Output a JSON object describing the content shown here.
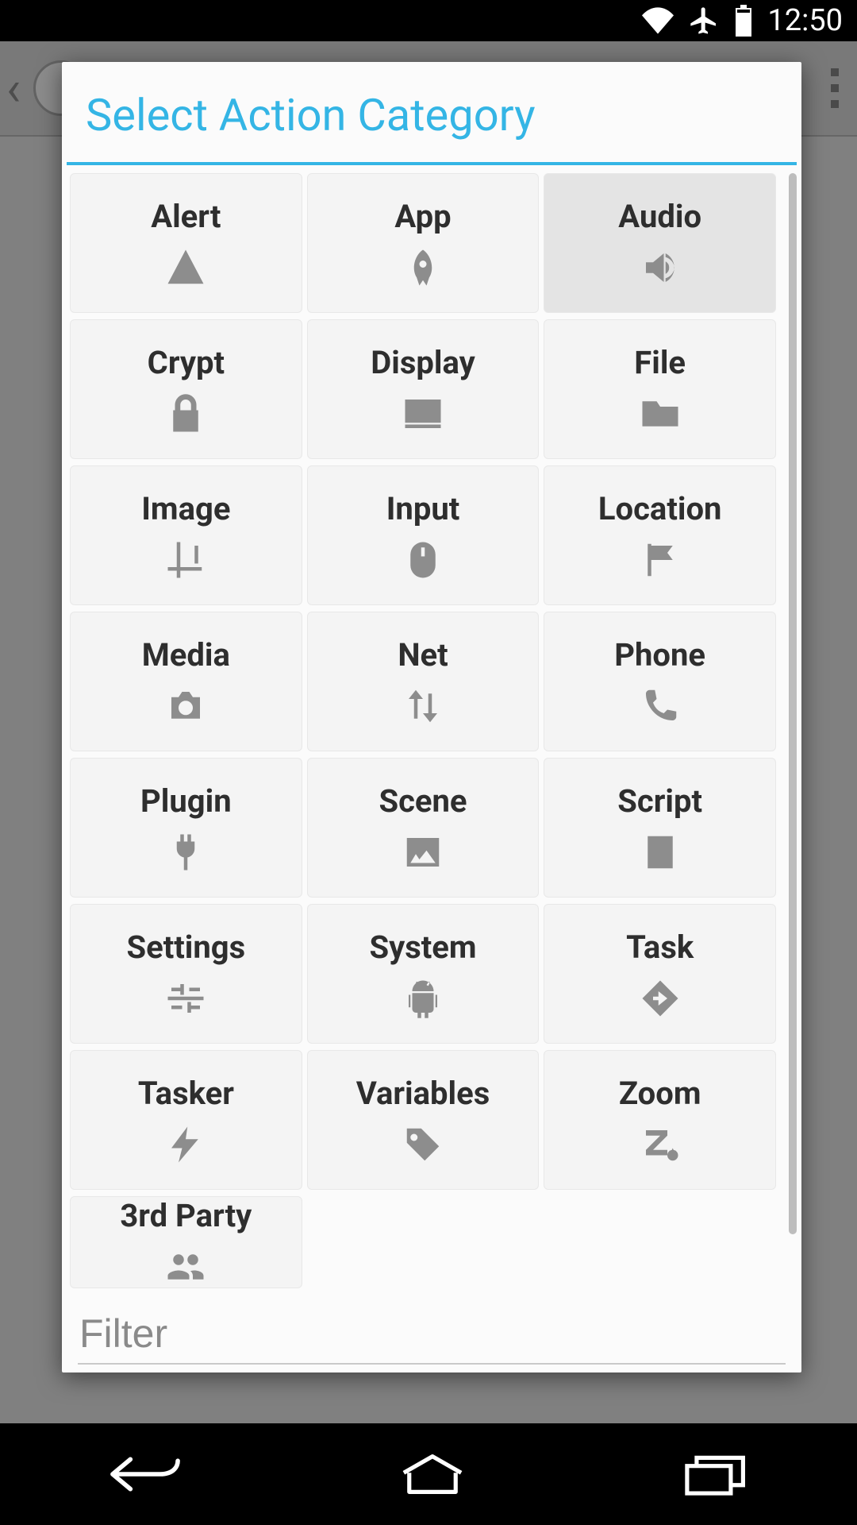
{
  "status": {
    "time": "12:50",
    "icons": [
      "wifi",
      "airplane",
      "battery"
    ]
  },
  "dialog": {
    "title": "Select Action Category",
    "filter_placeholder": "Filter",
    "selected_index": 2,
    "categories": [
      {
        "label": "Alert",
        "icon": "warning"
      },
      {
        "label": "App",
        "icon": "rocket"
      },
      {
        "label": "Audio",
        "icon": "speaker"
      },
      {
        "label": "Crypt",
        "icon": "lock"
      },
      {
        "label": "Display",
        "icon": "monitor"
      },
      {
        "label": "File",
        "icon": "folder"
      },
      {
        "label": "Image",
        "icon": "crop"
      },
      {
        "label": "Input",
        "icon": "mouse"
      },
      {
        "label": "Location",
        "icon": "flag"
      },
      {
        "label": "Media",
        "icon": "camera"
      },
      {
        "label": "Net",
        "icon": "updown"
      },
      {
        "label": "Phone",
        "icon": "phone"
      },
      {
        "label": "Plugin",
        "icon": "plug"
      },
      {
        "label": "Scene",
        "icon": "picture"
      },
      {
        "label": "Script",
        "icon": "doc-lines"
      },
      {
        "label": "Settings",
        "icon": "sliders"
      },
      {
        "label": "System",
        "icon": "android"
      },
      {
        "label": "Task",
        "icon": "diamond-turn"
      },
      {
        "label": "Tasker",
        "icon": "bolt"
      },
      {
        "label": "Variables",
        "icon": "tags"
      },
      {
        "label": "Zoom",
        "icon": "z-gear"
      },
      {
        "label": "3rd Party",
        "icon": "group"
      }
    ]
  },
  "colors": {
    "accent": "#34b5e5",
    "icon_gray": "#8d8d8d",
    "tile_bg": "#f4f4f4",
    "tile_selected": "#e4e4e4"
  }
}
